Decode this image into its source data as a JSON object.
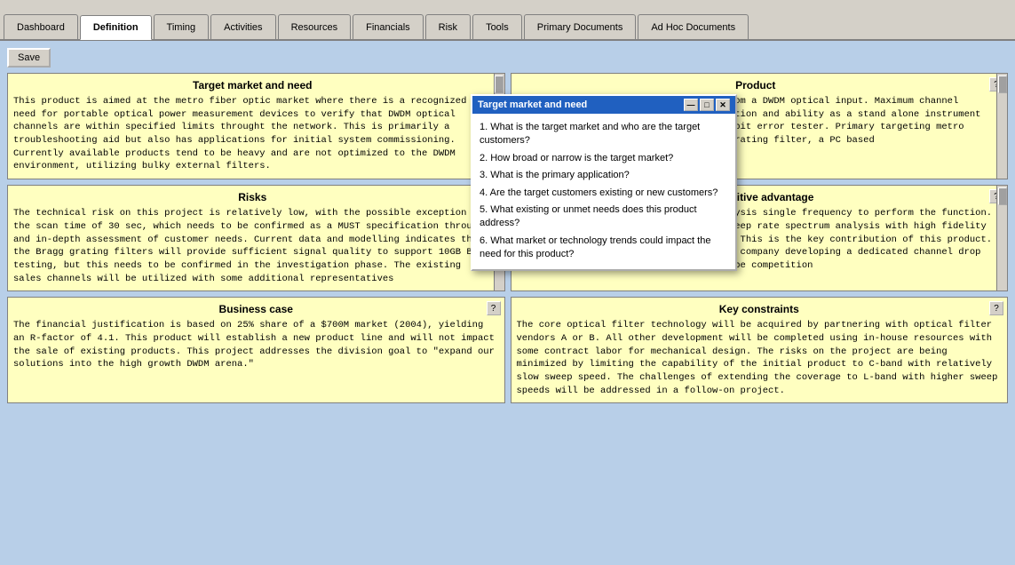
{
  "tabs": [
    {
      "label": "Dashboard",
      "active": false
    },
    {
      "label": "Definition",
      "active": true
    },
    {
      "label": "Timing",
      "active": false
    },
    {
      "label": "Activities",
      "active": false
    },
    {
      "label": "Resources",
      "active": false
    },
    {
      "label": "Financials",
      "active": false
    },
    {
      "label": "Risk",
      "active": false
    },
    {
      "label": "Tools",
      "active": false
    },
    {
      "label": "Primary Documents",
      "active": false
    },
    {
      "label": "Ad Hoc Documents",
      "active": false
    }
  ],
  "save_label": "Save",
  "panels": {
    "target_market": {
      "title": "Target market and need",
      "text": "This product is aimed at the metro fiber optic market where there is a recognized need for portable optical power measurement devices to verify that DWDM optical channels are within specified limits throught the network.  This is primarily a troubleshooting aid but also has applications for initial system commissioning.  Currently available products tend to be heavy and are not optimized to the DWDM environment, utilizing bulky external filters."
    },
    "product": {
      "title": "Product",
      "text": "Outputs a selectable, single channel from a DWDM optical input. Maximum channel spacing of 50MHz on basic channel detection and ability as a stand alone instrument or signal may be applied to an optical bit error tester.  Primary targeting metro fiber links.  The product uses a Bragg grating filter, a PC based"
    },
    "risks": {
      "title": "Risks",
      "text": "The technical risk on this project is relatively low, with the possible exception of the scan time of 30 sec, which needs to be confirmed as a MUST specification through and in-depth assessment of customer needs.  Current data and modelling indicates that the Bragg grating filters will provide sufficient signal quality to support 10GB BER testing, but this needs to be confirmed in the investigation phase.  The existing sales channels will be utilized with some additional representatives"
    },
    "competitive_advantage": {
      "title": "Competitive advantage",
      "text": "Solutions utilize optical spectrum analysis single frequency to perform the function.  However, optical filters enable high sweep rate spectrum analysis with high fidelity filtering as needed for rate BER tests. This is the key contribution of this product. We are not currently aware of any other company developing a dedicated channel drop unit, but it is likely that there will be competition"
    },
    "business_case": {
      "title": "Business case",
      "text": "The financial justification is based on 25% share of a $700M market (2004), yielding an R-factor of 4.1.  This product will establish a new product line and will not impact the sale of existing products.  This project addresses the division goal to \"expand our solutions into the high growth DWDM arena.\""
    },
    "key_constraints": {
      "title": "Key constraints",
      "text": "The core optical filter technology will be acquired by partnering with optical filter vendors A or B.  All other development will be completed using in-house resources with some contract labor for mechanical design.  The risks on the project are being minimized by limiting the capability of the initial product to C-band with relatively slow sweep speed.  The challenges of extending the coverage to L-band with higher sweep speeds will be addressed in a follow-on project."
    }
  },
  "popup": {
    "title": "Target market and need",
    "minimize_label": "—",
    "restore_label": "□",
    "close_label": "✕",
    "questions": [
      "1. What is the target market and who are the target customers?",
      "2. How broad or narrow is the target market?",
      "3. What is the primary application?",
      "4. Are the target customers existing or new customers?",
      "5. What existing or unmet needs does this product address?",
      "6. What market or technology trends could impact the need for this product?"
    ]
  },
  "help_label": "?",
  "colors": {
    "accent_blue": "#2060c0",
    "panel_yellow": "#ffffc0",
    "tab_active_bg": "#ffffff"
  }
}
